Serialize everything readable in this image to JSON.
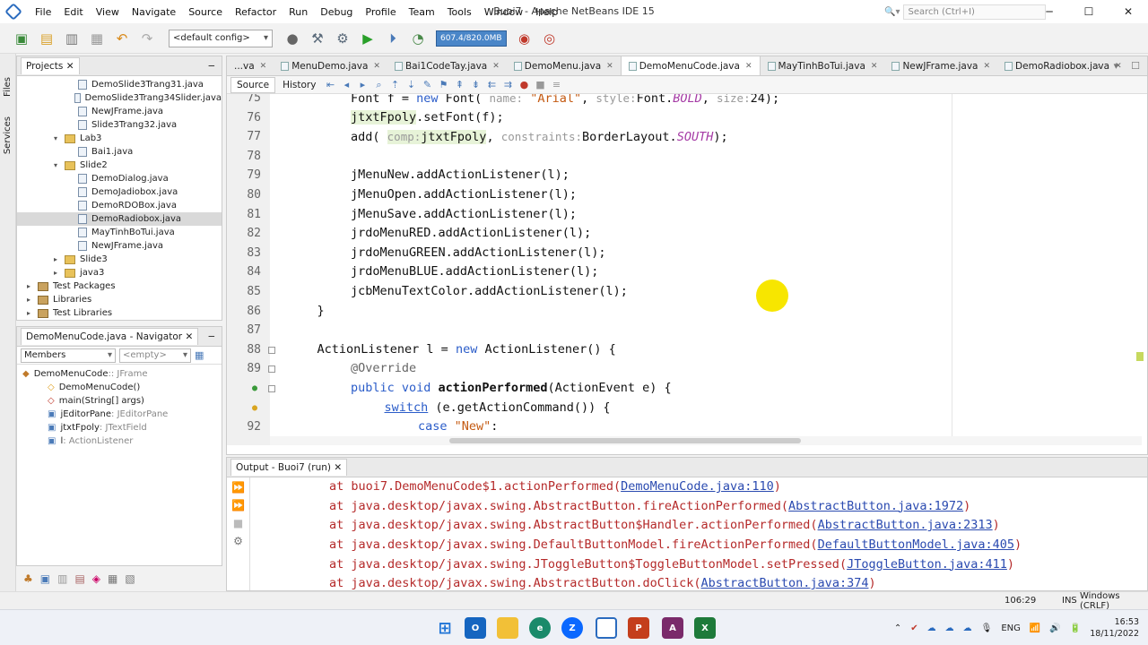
{
  "window": {
    "title": "Buoi7 - Apache NetBeans IDE 15",
    "menu": [
      "File",
      "Edit",
      "View",
      "Navigate",
      "Source",
      "Refactor",
      "Run",
      "Debug",
      "Profile",
      "Team",
      "Tools",
      "Window",
      "Help"
    ],
    "search_placeholder": "Search (Ctrl+I)",
    "buttons": {
      "minimize": "─",
      "maximize": "☐",
      "close": "✕"
    }
  },
  "toolbar": {
    "config_value": "<default config>",
    "memory": "607.4/820.0MB"
  },
  "left_strip": {
    "files": "Files",
    "services": "Services"
  },
  "projects": {
    "tab_label": "Projects",
    "items": [
      {
        "label": "DemoSlide3Trang31.java",
        "kind": "java",
        "indent": 4
      },
      {
        "label": "DemoSlide3Trang34Slider.java",
        "kind": "java",
        "indent": 4
      },
      {
        "label": "NewJFrame.java",
        "kind": "java",
        "indent": 4
      },
      {
        "label": "Slide3Trang32.java",
        "kind": "java",
        "indent": 4
      },
      {
        "label": "Lab3",
        "kind": "pkg",
        "indent": 3,
        "arrow": "▾"
      },
      {
        "label": "Bai1.java",
        "kind": "java",
        "indent": 4
      },
      {
        "label": "Slide2",
        "kind": "pkg",
        "indent": 3,
        "arrow": "▾"
      },
      {
        "label": "DemoDialog.java",
        "kind": "java",
        "indent": 4
      },
      {
        "label": "DemoJadiobox.java",
        "kind": "java",
        "indent": 4
      },
      {
        "label": "DemoRDOBox.java",
        "kind": "java",
        "indent": 4
      },
      {
        "label": "DemoRadiobox.java",
        "kind": "java",
        "indent": 4,
        "selected": true
      },
      {
        "label": "MayTinhBoTui.java",
        "kind": "java",
        "indent": 4
      },
      {
        "label": "NewJFrame.java",
        "kind": "java",
        "indent": 4
      },
      {
        "label": "Slide3",
        "kind": "pkg",
        "indent": 3,
        "arrow": "▸"
      },
      {
        "label": "java3",
        "kind": "pkg",
        "indent": 3,
        "arrow": "▸"
      },
      {
        "label": "Test Packages",
        "kind": "lib",
        "indent": 1,
        "arrow": "▸"
      },
      {
        "label": "Libraries",
        "kind": "lib",
        "indent": 1,
        "arrow": "▸"
      },
      {
        "label": "Test Libraries",
        "kind": "lib",
        "indent": 1,
        "arrow": "▸"
      }
    ]
  },
  "navigator": {
    "tab_label": "DemoMenuCode.java - Navigator",
    "filter_value": "Members",
    "filter2_value": "<empty>",
    "items": [
      {
        "name": "DemoMenuCode",
        "type": " :: JFrame",
        "indent": 0
      },
      {
        "name": "DemoMenuCode()",
        "type": "",
        "indent": 1
      },
      {
        "name": "main(String[] args)",
        "type": "",
        "indent": 1
      },
      {
        "name": "jEditorPane",
        "type": " : JEditorPane",
        "indent": 1
      },
      {
        "name": "jtxtFpoly",
        "type": " : JTextField",
        "indent": 1
      },
      {
        "name": "l",
        "type": " : ActionListener",
        "indent": 1
      }
    ]
  },
  "editor": {
    "tabs": [
      {
        "label": "...va",
        "active": false
      },
      {
        "label": "MenuDemo.java",
        "active": false
      },
      {
        "label": "Bai1CodeTay.java",
        "active": false
      },
      {
        "label": "DemoMenu.java",
        "active": false
      },
      {
        "label": "DemoMenuCode.java",
        "active": true
      },
      {
        "label": "MayTinhBoTui.java",
        "active": false
      },
      {
        "label": "NewJFrame.java",
        "active": false
      },
      {
        "label": "DemoRadiobox.java",
        "active": false
      }
    ],
    "source_label": "Source",
    "history_label": "History",
    "lines": [
      {
        "n": "75",
        "html": "Font f = <span class=\"kw\">new</span> Font( <span class=\"hint\">name:</span> <span class=\"str\">\"Arial\"</span>, <span class=\"hint\">style:</span>Font.<span class=\"it\">BOLD</span>, <span class=\"hint\">size:</span>24);",
        "ind": 0
      },
      {
        "n": "76",
        "html": "<span class=\"hl\">jtxtFpoly</span>.setFont(f);",
        "ind": 0
      },
      {
        "n": "77",
        "html": "add( <span class=\"hl\"><span class=\"hint\">comp:</span>jtxtFpoly</span>, <span class=\"hint\">constraints:</span>BorderLayout.<span class=\"it\">SOUTH</span>);",
        "ind": 0
      },
      {
        "n": "78",
        "html": "",
        "ind": 0
      },
      {
        "n": "79",
        "html": "jMenuNew.addActionListener(l);",
        "ind": 0
      },
      {
        "n": "80",
        "html": "jMenuOpen.addActionListener(l);",
        "ind": 0
      },
      {
        "n": "81",
        "html": "jMenuSave.addActionListener(l);",
        "ind": 0
      },
      {
        "n": "82",
        "html": "jrdoMenuRED.addActionListener(l);",
        "ind": 0
      },
      {
        "n": "83",
        "html": "jrdoMenuGREEN.addActionListener(l);",
        "ind": 0
      },
      {
        "n": "84",
        "html": "jrdoMenuBLUE.addActionListener(l);",
        "ind": 0
      },
      {
        "n": "85",
        "html": "jcbMenuTextColor.addActionListener(l);",
        "ind": 0
      },
      {
        "n": "86",
        "html": "}",
        "ind": -1
      },
      {
        "n": "87",
        "html": "",
        "ind": 0
      },
      {
        "n": "88",
        "html": "ActionListener l = <span class=\"kw\">new</span> ActionListener() {",
        "ind": -1
      },
      {
        "n": "89",
        "html": "<span class=\"ann\">@Override</span>",
        "ind": 0
      },
      {
        "n": "",
        "html": "<span class=\"kw\">public void</span> <span class=\"bold\">actionPerformed</span>(ActionEvent e) {",
        "ind": 0
      },
      {
        "n": "",
        "html": "<span class=\"kw\" style=\"text-decoration:underline\">switch</span> (e.getActionCommand()) {",
        "ind": 1
      },
      {
        "n": "92",
        "html": "<span class=\"kw\">case</span> <span class=\"str\">\"New\"</span>:",
        "ind": 2
      }
    ]
  },
  "output": {
    "tab_label": "Output - Buoi7 (run)",
    "lines": [
      {
        "text": "at buoi7.DemoMenuCode$1.actionPerformed(",
        "link": "DemoMenuCode.java:110",
        "end": ")"
      },
      {
        "text": "at java.desktop/javax.swing.AbstractButton.fireActionPerformed(",
        "link": "AbstractButton.java:1972",
        "end": ")"
      },
      {
        "text": "at java.desktop/javax.swing.AbstractButton$Handler.actionPerformed(",
        "link": "AbstractButton.java:2313",
        "end": ")"
      },
      {
        "text": "at java.desktop/javax.swing.DefaultButtonModel.fireActionPerformed(",
        "link": "DefaultButtonModel.java:405",
        "end": ")"
      },
      {
        "text": "at java.desktop/javax.swing.JToggleButton$ToggleButtonModel.setPressed(",
        "link": "JToggleButton.java:411",
        "end": ")"
      },
      {
        "text": "at java.desktop/javax.swing.AbstractButton.doClick(",
        "link": "AbstractButton.java:374",
        "end": ")"
      }
    ]
  },
  "status": {
    "position": "106:29",
    "mode": "INS",
    "eol": "Windows (CRLF)"
  },
  "taskbar": {
    "lang": "ENG",
    "time": "16:53",
    "date": "18/11/2022"
  }
}
